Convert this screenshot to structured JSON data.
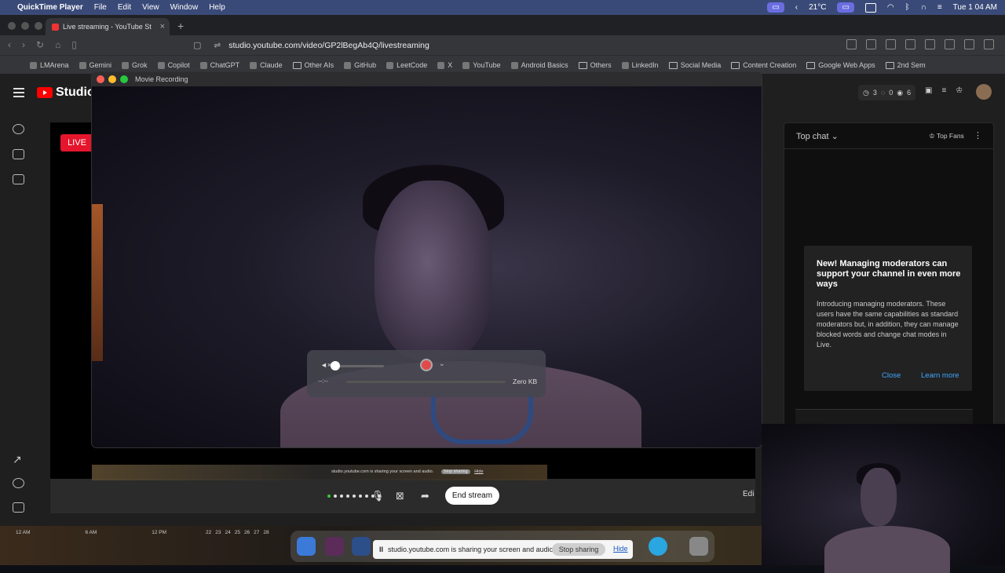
{
  "menubar": {
    "app": "QuickTime Player",
    "items": [
      "File",
      "Edit",
      "View",
      "Window",
      "Help"
    ],
    "weather": "21°C",
    "clock": "Tue 1 04 AM"
  },
  "browser": {
    "tab_title": "Live streaming - YouTube St",
    "url": "studio.youtube.com/video/GP2lBegAb4Q/livestreaming",
    "bookmarks": [
      "LMArena",
      "Gemini",
      "Grok",
      "Copilot",
      "ChatGPT",
      "Claude",
      "Other AIs",
      "GitHub",
      "LeetCode",
      "X",
      "YouTube",
      "Android Basics",
      "Others",
      "LinkedIn",
      "Social Media",
      "Content Creation",
      "Google Web Apps",
      "2nd Sem"
    ]
  },
  "studio": {
    "logo": "Studio",
    "live_badge": "LIVE",
    "stats": {
      "watching": "3",
      "likes": "0",
      "views": "6"
    },
    "controls": {
      "end_stream": "End stream",
      "edit": "Edi"
    },
    "chat": {
      "mode": "Top chat",
      "top_fans": "Top Fans",
      "notice_title": "New! Managing moderators can support your channel in even more ways",
      "notice_body": "Introducing managing moderators. These users have the same capabilities as standard moderators but, in addition, they can manage blocked words and change chat modes in Live.",
      "close": "Close",
      "learn_more": "Learn more"
    }
  },
  "quicktime": {
    "title": "Movie Recording",
    "time": "--:--",
    "size": "Zero KB"
  },
  "screen_share": {
    "message": "studio.youtube.com is sharing your screen and audio.",
    "stop": "Stop sharing",
    "hide": "Hide"
  },
  "mini_share": {
    "message": "studio.youtube.com is sharing your screen and audio.",
    "stop": "Stop sharing",
    "hide": "Hide"
  },
  "timeline": {
    "labels": [
      "12 AM",
      "6 AM",
      "12 PM"
    ],
    "dates": [
      "22",
      "23",
      "24",
      "25",
      "26",
      "27",
      "28"
    ]
  }
}
